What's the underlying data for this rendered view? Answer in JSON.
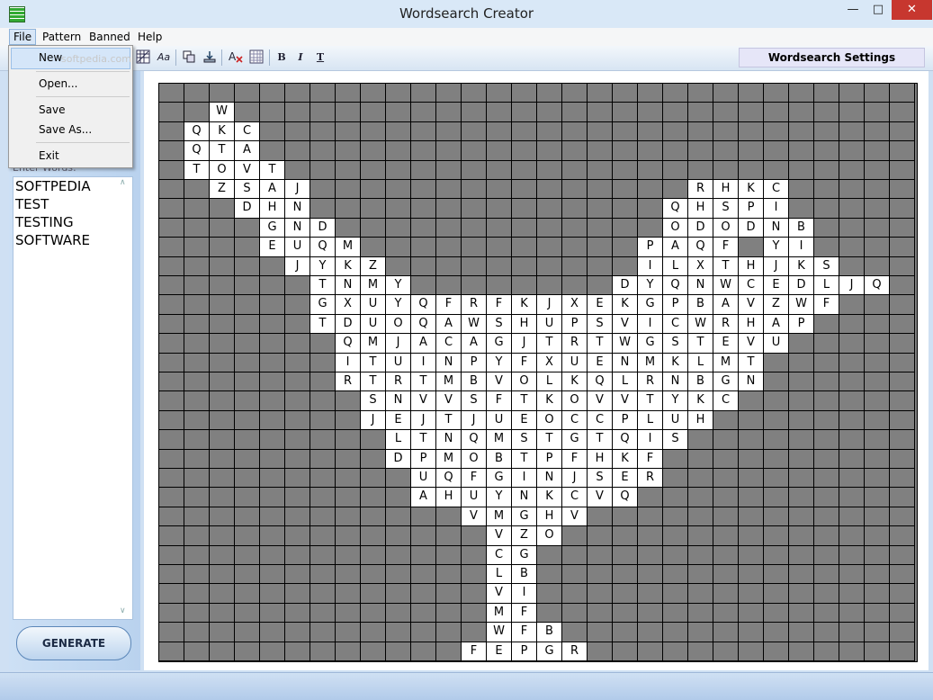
{
  "window": {
    "title": "Wordsearch Creator",
    "min_glyph": "—",
    "max_glyph": "□",
    "close_glyph": "✕"
  },
  "menu": {
    "file": "File",
    "pattern": "Pattern",
    "banned": "Banned",
    "help": "Help"
  },
  "file_menu": {
    "new": "New",
    "open": "Open...",
    "save": "Save",
    "save_as": "Save As...",
    "exit": "Exit"
  },
  "watermark": "softpedia.com",
  "toolbar": {
    "font_glyph": "Aa",
    "bold": "B",
    "italic": "I",
    "text": "T",
    "icons": [
      "pattern-icon",
      "font-icon",
      "copy-icon",
      "export-icon",
      "clear-format-icon",
      "grid-icon",
      "bold-icon",
      "italic-icon",
      "text-icon"
    ]
  },
  "settings_tab": "Wordsearch Settings",
  "words_label": "Enter Words:",
  "words": [
    "SOFTPEDIA",
    "TEST",
    "TESTING",
    "SOFTWARE"
  ],
  "scroll_up_glyph": "∧",
  "scroll_down_glyph": "∨",
  "generate_button": "GENERATE",
  "grid": {
    "cols": 30,
    "rows": 30,
    "rows_data": [
      "",
      "2:W",
      "1:QKC",
      "1:QTA",
      "1:TOVT",
      "2:ZSAJ|21:RHKC",
      "3:DHN|20:QHSPI",
      "4:GND|20:ODODNB",
      "4:EUQM|19:PAQF|24:YI",
      "5:JYKZ|19:ILXTHJKS",
      "6:TNMY|18:DYQNWCEDLJQ",
      "6:GXUYQFRFKJXEKGPBAVZWF",
      "6:TDUOQAWSHUPSVICWRHAP",
      "7:QMJACAGJTRTWGSTEVU",
      "7:ITUINPYFXUENMKLMT",
      "7:RTRTMBVOLKQLRNBGN",
      "8:SNVVSFTKOVVTYKC",
      "8:JEJTJUEOCCPLUH",
      "9:LTNQMSTGTQIS",
      "9:DPMOBTPFHKF",
      "10:UQFGINJSER",
      "10:AHUYNKCVQ",
      "12:VMGHV",
      "13:VZO",
      "13:CG",
      "13:LB",
      "13:VI",
      "13:MF",
      "13:WFB",
      "12:FEPGR"
    ]
  }
}
